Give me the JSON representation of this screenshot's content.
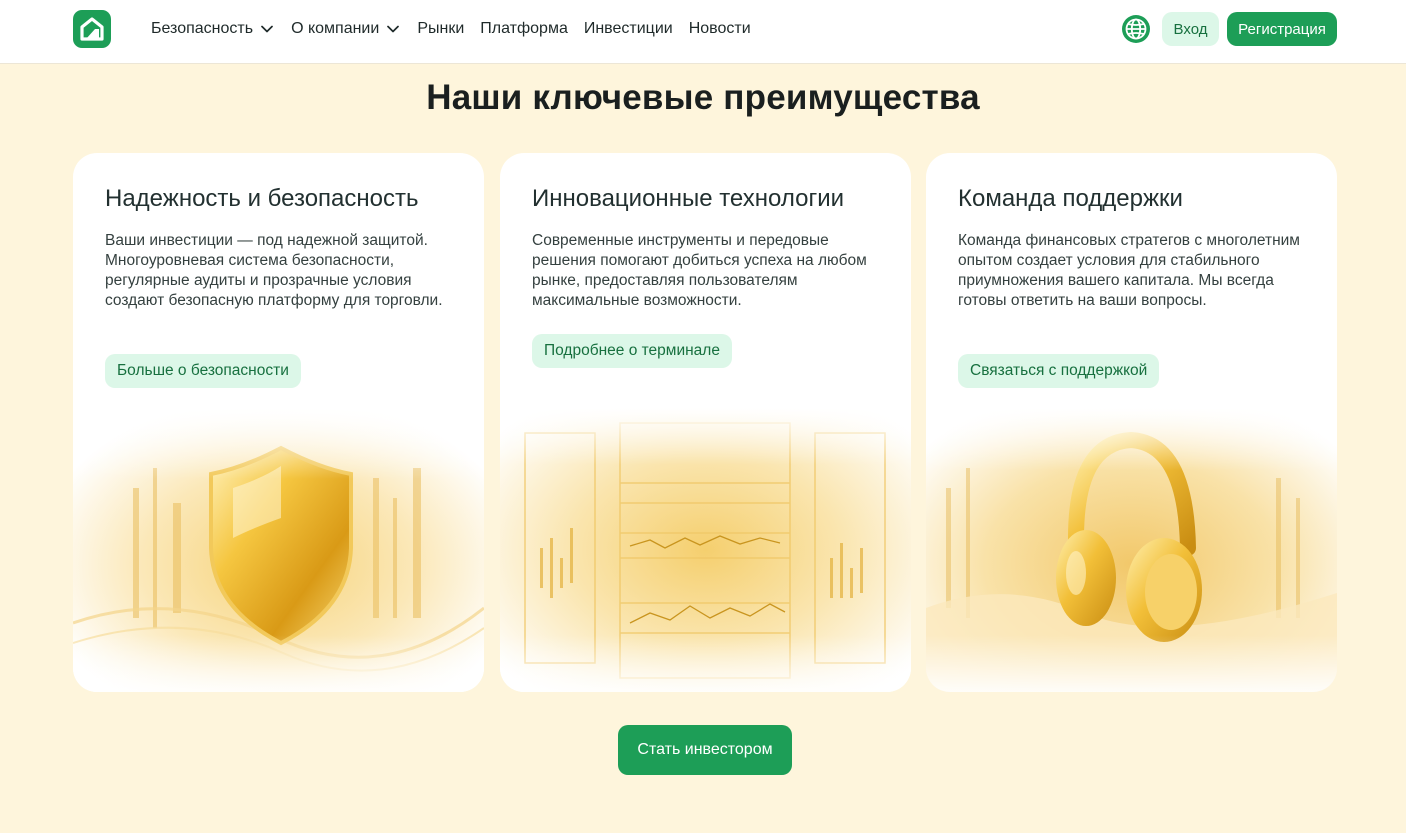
{
  "header": {
    "nav": [
      {
        "label": "Безопасность",
        "has_dropdown": true
      },
      {
        "label": "О компании",
        "has_dropdown": true
      },
      {
        "label": "Рынки",
        "has_dropdown": false
      },
      {
        "label": "Платформа",
        "has_dropdown": false
      },
      {
        "label": "Инвестиции",
        "has_dropdown": false
      },
      {
        "label": "Новости",
        "has_dropdown": false
      }
    ],
    "login_label": "Вход",
    "register_label": "Регистрация",
    "icons": {
      "logo": "brand-logo-icon",
      "language": "globe-icon",
      "dropdown": "chevron-down-icon"
    }
  },
  "main": {
    "title": "Наши ключевые преимущества",
    "cards": [
      {
        "title": "Надежность и безопасность",
        "text": "Ваши инвестиции — под надежной защитой. Многоуровневая система безопасности, регулярные аудиты и прозрачные условия создают безопасную платформу для торговли.",
        "link": "Больше о безопасности",
        "illustration": "gold-shield-icon"
      },
      {
        "title": "Инновационные технологии",
        "text": "Современные инструменты и передовые решения помогают добиться успеха на любом рынке, предоставляя пользователям максимальные возможности.",
        "link": "Подробнее о терминале",
        "illustration": "trading-terminal-icon"
      },
      {
        "title": "Команда поддержки",
        "text": "Команда финансовых стратегов с многолетним опытом создает условия для стабильного приумножения вашего капитала. Мы всегда готовы ответить на ваши вопросы.",
        "link": "Связаться с поддержкой",
        "illustration": "gold-headphones-icon"
      }
    ],
    "cta_label": "Стать инвестором"
  },
  "colors": {
    "page_background": "#fef5dc",
    "brand_green": "#1d9e57",
    "light_green": "#dcf7e8",
    "link_green": "#17703f",
    "gold": "#e8b530"
  }
}
